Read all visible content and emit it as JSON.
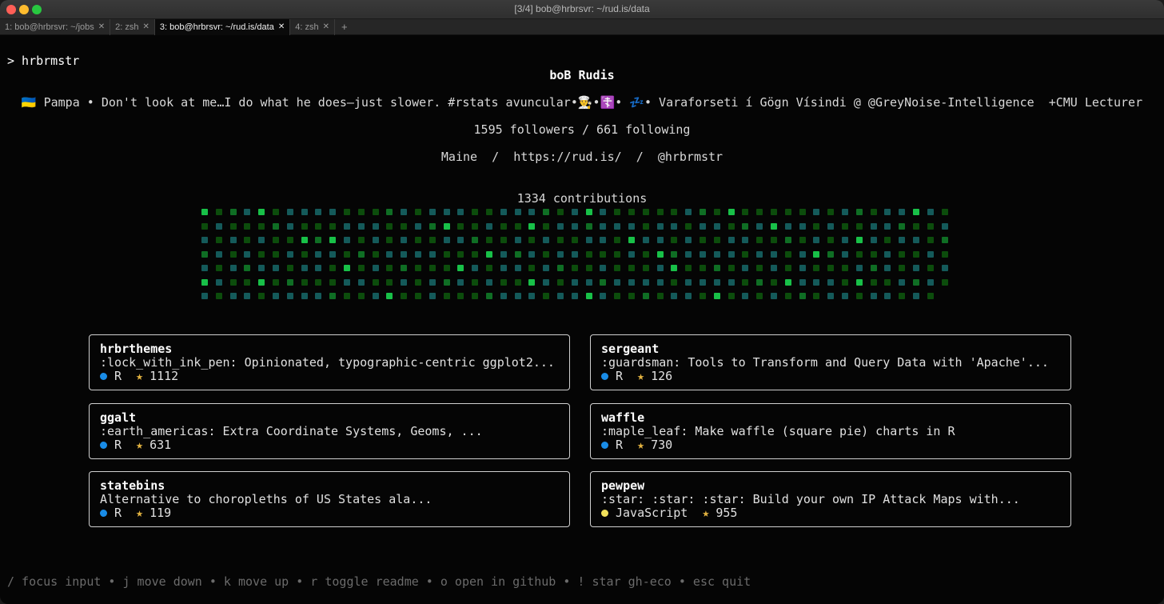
{
  "window": {
    "title": "[3/4] bob@hrbrsvr: ~/rud.is/data",
    "tabs": [
      {
        "label": "1: bob@hrbrsvr: ~/jobs",
        "active": false
      },
      {
        "label": "2: zsh",
        "active": false
      },
      {
        "label": "3: bob@hrbrsvr: ~/rud.is/data",
        "active": true
      },
      {
        "label": "4: zsh",
        "active": false
      }
    ],
    "close_glyph": "✕",
    "add_tab": "+"
  },
  "prompt": "> hrbrmstr",
  "profile": {
    "name": "boB Rudis",
    "bio": "🇺🇦 Pampa • Don't look at me…I do what he does—just slower. #rstats avuncular•👨‍🍳•☦️• 💤• Varaforseti í Gögn Vísindi @ @GreyNoise-Intelligence  +CMU Lecturer",
    "followers_line": "1595 followers / 661 following",
    "links_line": "Maine  /  https://rud.is/  /  @hrbrmstr"
  },
  "contributions": {
    "label": "1334 contributions",
    "palette": [
      "#145a5a",
      "#0c4c0c",
      "#0f6e24",
      "#18c048"
    ],
    "weeks": 53,
    "days": 7,
    "last_week_days": 6,
    "pattern": "0101010010101001010101001001010100101001010010100101010101000101001000100100101010101001010100100101001010101000001010010100100101001001010010101001001101010101010010010101001010100100101001010010000101001000101010101001001010010010101001010010001010101010100101101010010100101010101001001000101010000101001010101001011001010100101101010010010101001001"
  },
  "repos": [
    {
      "name": "hrbrthemes",
      "desc": ":lock_with_ink_pen: Opinionated, typographic-centric ggplot2...",
      "lang": "R",
      "lang_color": "#198ce7",
      "stars": "1112"
    },
    {
      "name": "sergeant",
      "desc": ":guardsman: Tools to Transform and Query Data with 'Apache'...",
      "lang": "R",
      "lang_color": "#198ce7",
      "stars": "126"
    },
    {
      "name": "ggalt",
      "desc": ":earth_americas: Extra Coordinate Systems, Geoms, ...",
      "lang": "R",
      "lang_color": "#198ce7",
      "stars": "631"
    },
    {
      "name": "waffle",
      "desc": ":maple_leaf: Make waffle (square pie) charts in R",
      "lang": "R",
      "lang_color": "#198ce7",
      "stars": "730"
    },
    {
      "name": "statebins",
      "desc": "Alternative to choropleths of US States ala...",
      "lang": "R",
      "lang_color": "#198ce7",
      "stars": "119"
    },
    {
      "name": "pewpew",
      "desc": ":star: :star: :star: Build your own IP Attack Maps with...",
      "lang": "JavaScript",
      "lang_color": "#f1e05a",
      "stars": "955"
    }
  ],
  "star_glyph": "★",
  "footer": "/ focus input • j move down • k move up • r toggle readme • o open in github • ! star gh-eco • esc quit"
}
